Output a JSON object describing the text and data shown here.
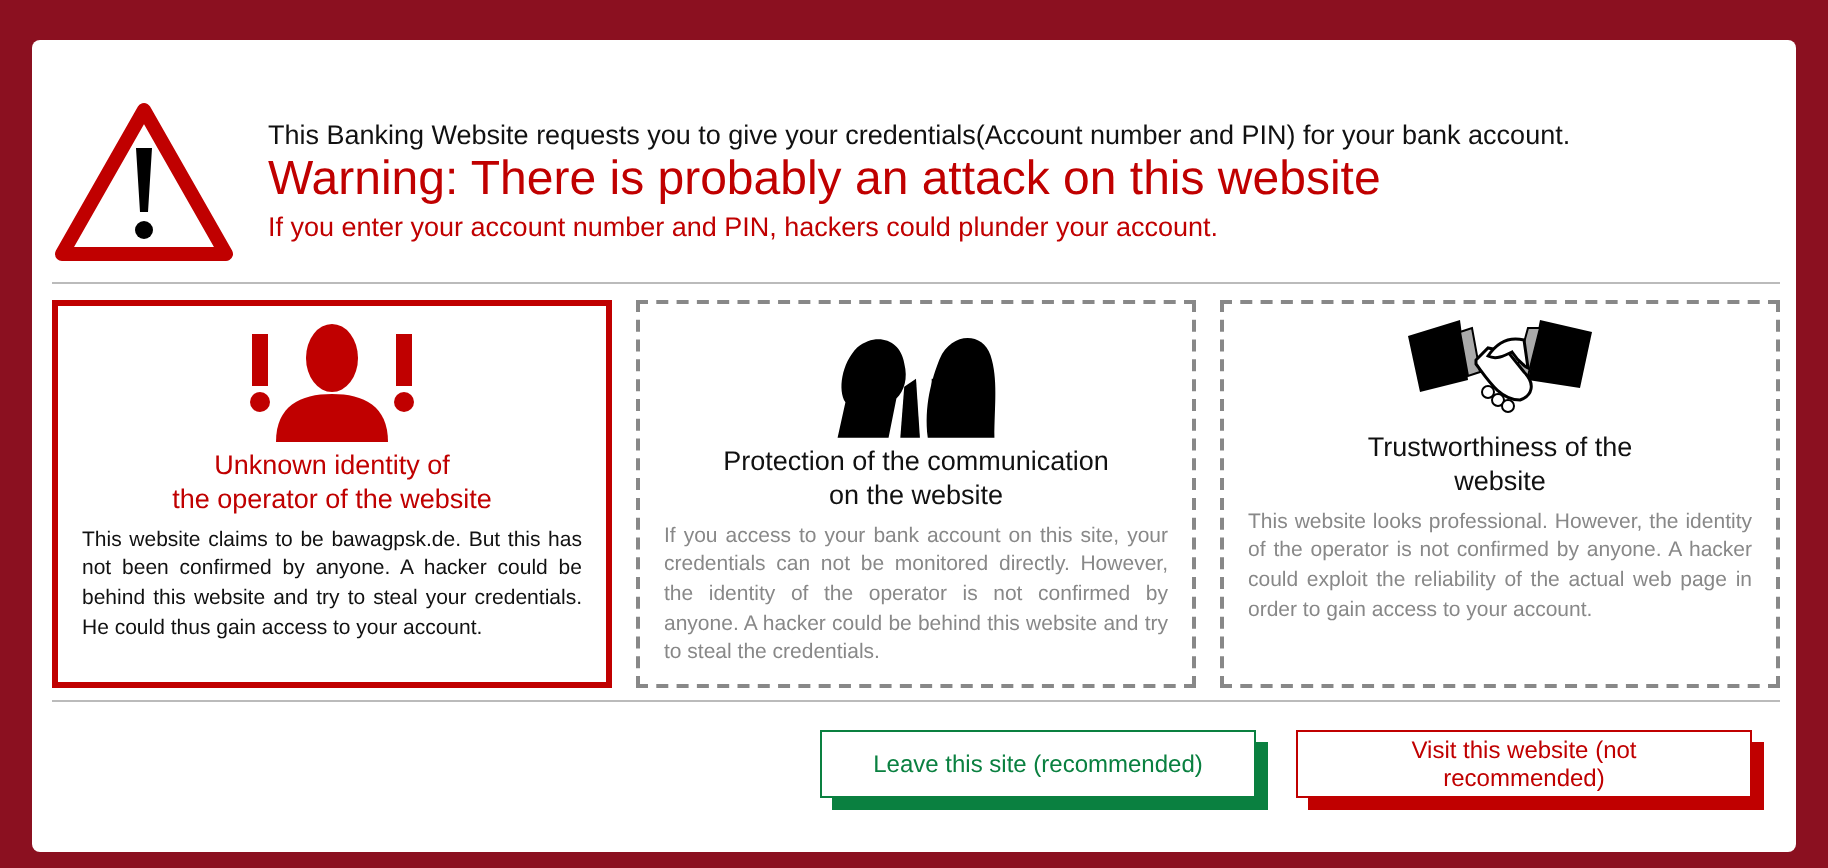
{
  "header": {
    "intro": "This Banking Website requests you to give your credentials(Account number and PIN) for your bank account.",
    "warning": "Warning: There is probably an attack on this website",
    "consequence": "If you enter your account number and PIN, hackers could plunder your account."
  },
  "cards": [
    {
      "kind": "identity",
      "selected": true,
      "title": "Unknown identity of\nthe operator of the website",
      "text": "This website claims to be bawagpsk.de. But this has not been confirmed by anyone. A hacker could be behind this website and try to steal your credentials. He could thus gain access to your account."
    },
    {
      "kind": "privacy",
      "selected": false,
      "title": "Protection of the communication\non the website",
      "text": "If you access to your bank account on this site, your credentials can not be monitored directly. However, the identity of the operator is not confirmed by anyone. A hacker could be behind this website and try to steal the credentials."
    },
    {
      "kind": "trust",
      "selected": false,
      "title": "Trustworthiness of the\nwebsite",
      "text": "This website looks professional. However, the identity of the operator is not confirmed by anyone. A hacker could exploit the reliability of the actual web page in order to gain access to your account."
    }
  ],
  "buttons": [
    {
      "label": "Leave this site (recommended)",
      "color": "#0a8040"
    },
    {
      "label": "Visit this website (not recommended)",
      "color": "#c00000"
    }
  ]
}
